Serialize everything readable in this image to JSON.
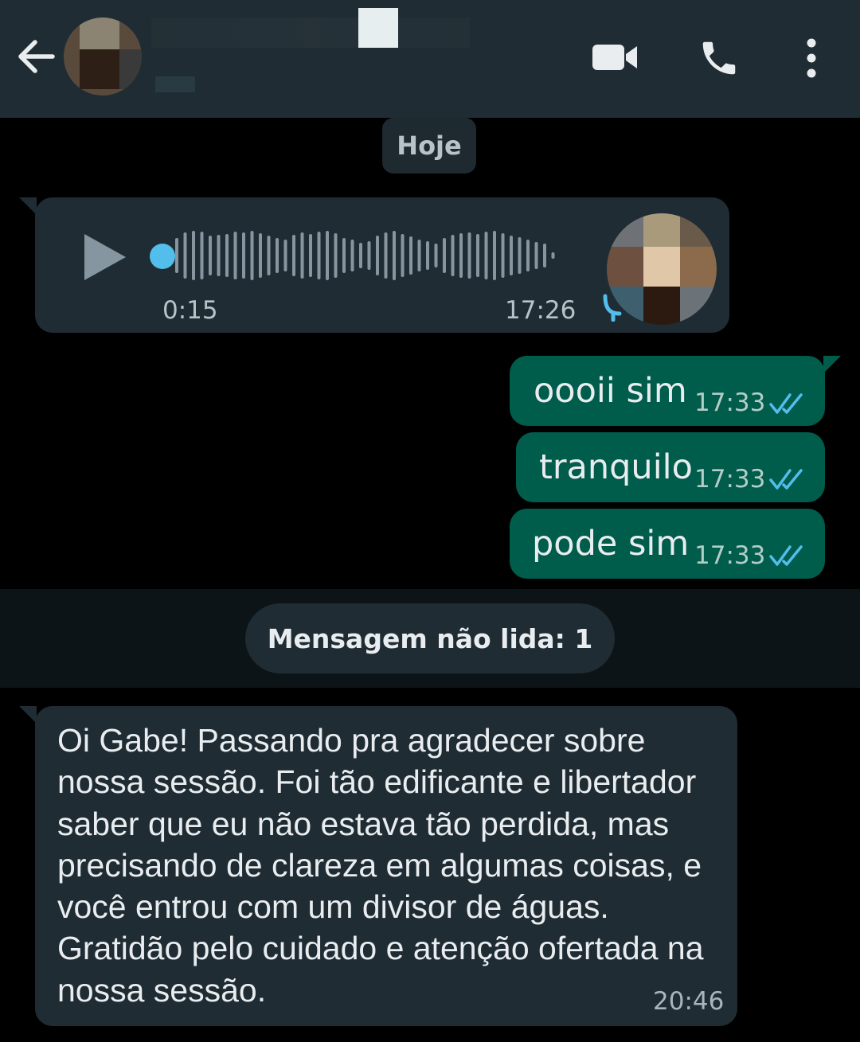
{
  "header": {
    "back_icon": "arrow-left-icon",
    "actions": [
      "video-call-icon",
      "phone-call-icon",
      "more-vert-icon"
    ]
  },
  "date_divider": "Hoje",
  "voice_message": {
    "duration": "0:15",
    "time": "17:26",
    "icon": "play-icon",
    "accent": "#53bdeb"
  },
  "outgoing": [
    {
      "text": "oooii sim",
      "time": "17:33",
      "status": "read-ticks-icon"
    },
    {
      "text": "tranquilo",
      "time": "17:33",
      "status": "read-ticks-icon"
    },
    {
      "text": "pode sim",
      "time": "17:33",
      "status": "read-ticks-icon"
    }
  ],
  "unread_divider": "Mensagem não lida: 1",
  "incoming_text": {
    "text": "Oi Gabe! Passando pra agradecer sobre nossa sessão.  Foi tão edificante e libertador saber que eu não estava tão perdida, mas precisando de clareza em algumas coisas, e você entrou com um divisor de águas. Gratidão pelo cuidado e atenção ofertada na nossa sessão.",
    "time": "20:46"
  },
  "colors": {
    "header_bg": "#1f2c34",
    "incoming_bubble": "#1f2c34",
    "outgoing_bubble": "#005c4b",
    "read_ticks": "#53bdeb",
    "chat_bg": "#000000"
  }
}
